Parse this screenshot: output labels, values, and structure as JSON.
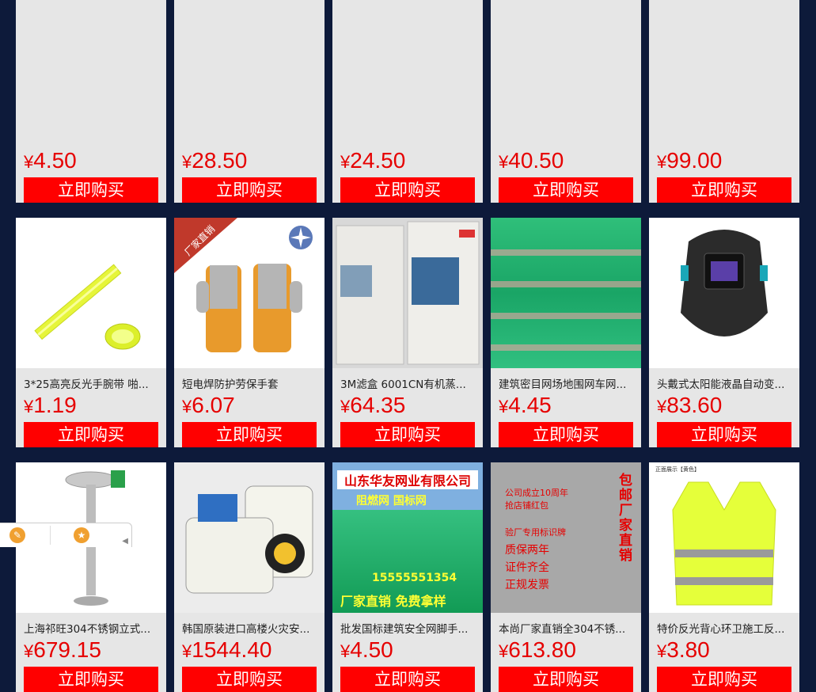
{
  "buy_label": "立即购买",
  "row0": [
    {
      "price": "4.50"
    },
    {
      "price": "28.50"
    },
    {
      "price": "24.50"
    },
    {
      "price": "40.50"
    },
    {
      "price": "99.00"
    }
  ],
  "row1": [
    {
      "title": "3*25高亮反光手腕带 啪...",
      "price": "1.19",
      "image": "reflective-wristband-image"
    },
    {
      "title": "短电焊防护劳保手套",
      "price": "6.07",
      "image": "welding-gloves-image",
      "ribbon": "厂家直销"
    },
    {
      "title": "3M滤盒 6001CN有机蒸...",
      "price": "64.35",
      "image": "filter-cartridge-image"
    },
    {
      "title": "建筑密目网场地围网车网...",
      "price": "4.45",
      "image": "green-net-stack-image"
    },
    {
      "title": "头戴式太阳能液晶自动变...",
      "price": "83.60",
      "image": "welding-helmet-image"
    }
  ],
  "row2": [
    {
      "title": "上海祁旺304不锈钢立式...",
      "price": "679.15",
      "image": "eyewash-station-image"
    },
    {
      "title": "韩国原装进口高楼火灾安...",
      "price": "1544.40",
      "image": "fire-escape-device-image"
    },
    {
      "title": "批发国标建筑安全网脚手...",
      "price": "4.50",
      "image": "safety-net-banner-image",
      "banner_top": "山东华友网业有限公司",
      "banner_sub": "阻燃网 国标网",
      "banner_phone": "15555551354",
      "banner_bottom": "厂家直销 免费拿样"
    },
    {
      "title": "本尚厂家直销全304不锈...",
      "price": "613.80",
      "image": "shower-eyewash-image",
      "poster_side": "包邮 厂家直销",
      "poster_line1": "公司成立10周年",
      "poster_line2": "抢店铺红包",
      "poster_line3": "验厂专用标识牌",
      "poster_line4": "质保两年",
      "poster_line5": "证件齐全",
      "poster_line6": "正规发票"
    },
    {
      "title": "特价反光背心环卫施工反...",
      "price": "3.80",
      "image": "reflective-vest-image",
      "vest_caption": "正面展示【黄色】"
    }
  ],
  "currency": "¥",
  "colors": {
    "accent": "#ff0000",
    "price": "#e60000",
    "page_bg": "#0d1a3a"
  }
}
